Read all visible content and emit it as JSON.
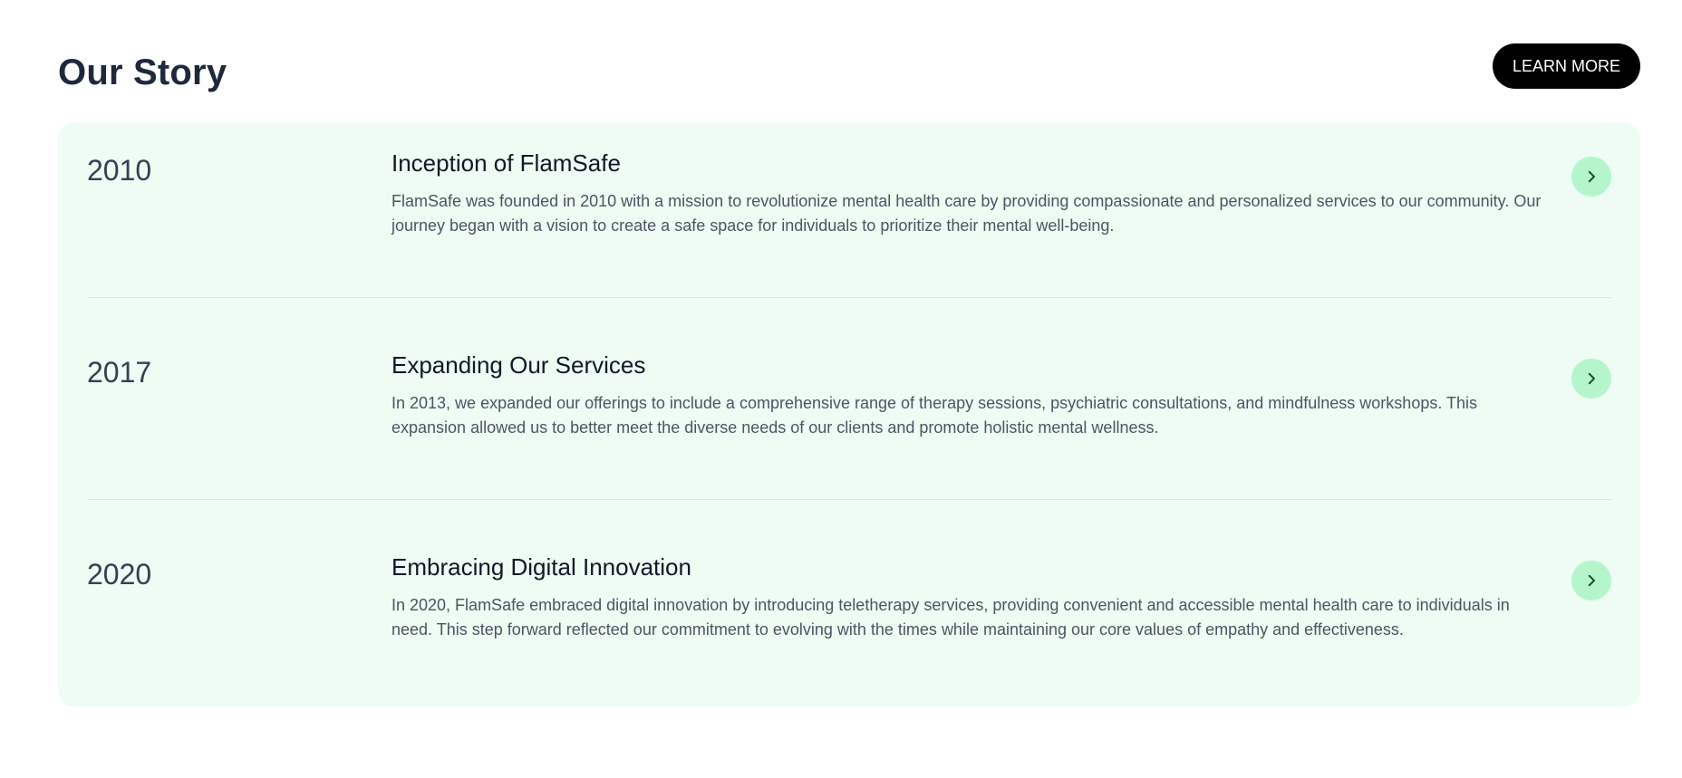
{
  "header": {
    "title": "Our Story",
    "learn_more_label": "LEARN MORE"
  },
  "story": {
    "items": [
      {
        "year": "2010",
        "title": "Inception of FlamSafe",
        "description": "FlamSafe was founded in 2010 with a mission to revolutionize mental health care by providing compassionate and personalized services to our community. Our journey began with a vision to create a safe space for individuals to prioritize their mental well-being."
      },
      {
        "year": "2017",
        "title": "Expanding Our Services",
        "description": "In 2013, we expanded our offerings to include a comprehensive range of therapy sessions, psychiatric consultations, and mindfulness workshops. This expansion allowed us to better meet the diverse needs of our clients and promote holistic mental wellness."
      },
      {
        "year": "2020",
        "title": "Embracing Digital Innovation",
        "description": "In 2020, FlamSafe embraced digital innovation by introducing teletherapy services, providing convenient and accessible mental health care to individuals in need. This step forward reflected our commitment to evolving with the times while maintaining our core values of empathy and effectiveness."
      }
    ],
    "arrow_icon": "chevron-right-icon"
  },
  "colors": {
    "card_background": "#eefcf3",
    "arrow_button_background": "#b5f5cc",
    "primary_button_background": "#000000",
    "primary_button_text": "#ffffff",
    "title_text": "#1e293b"
  }
}
